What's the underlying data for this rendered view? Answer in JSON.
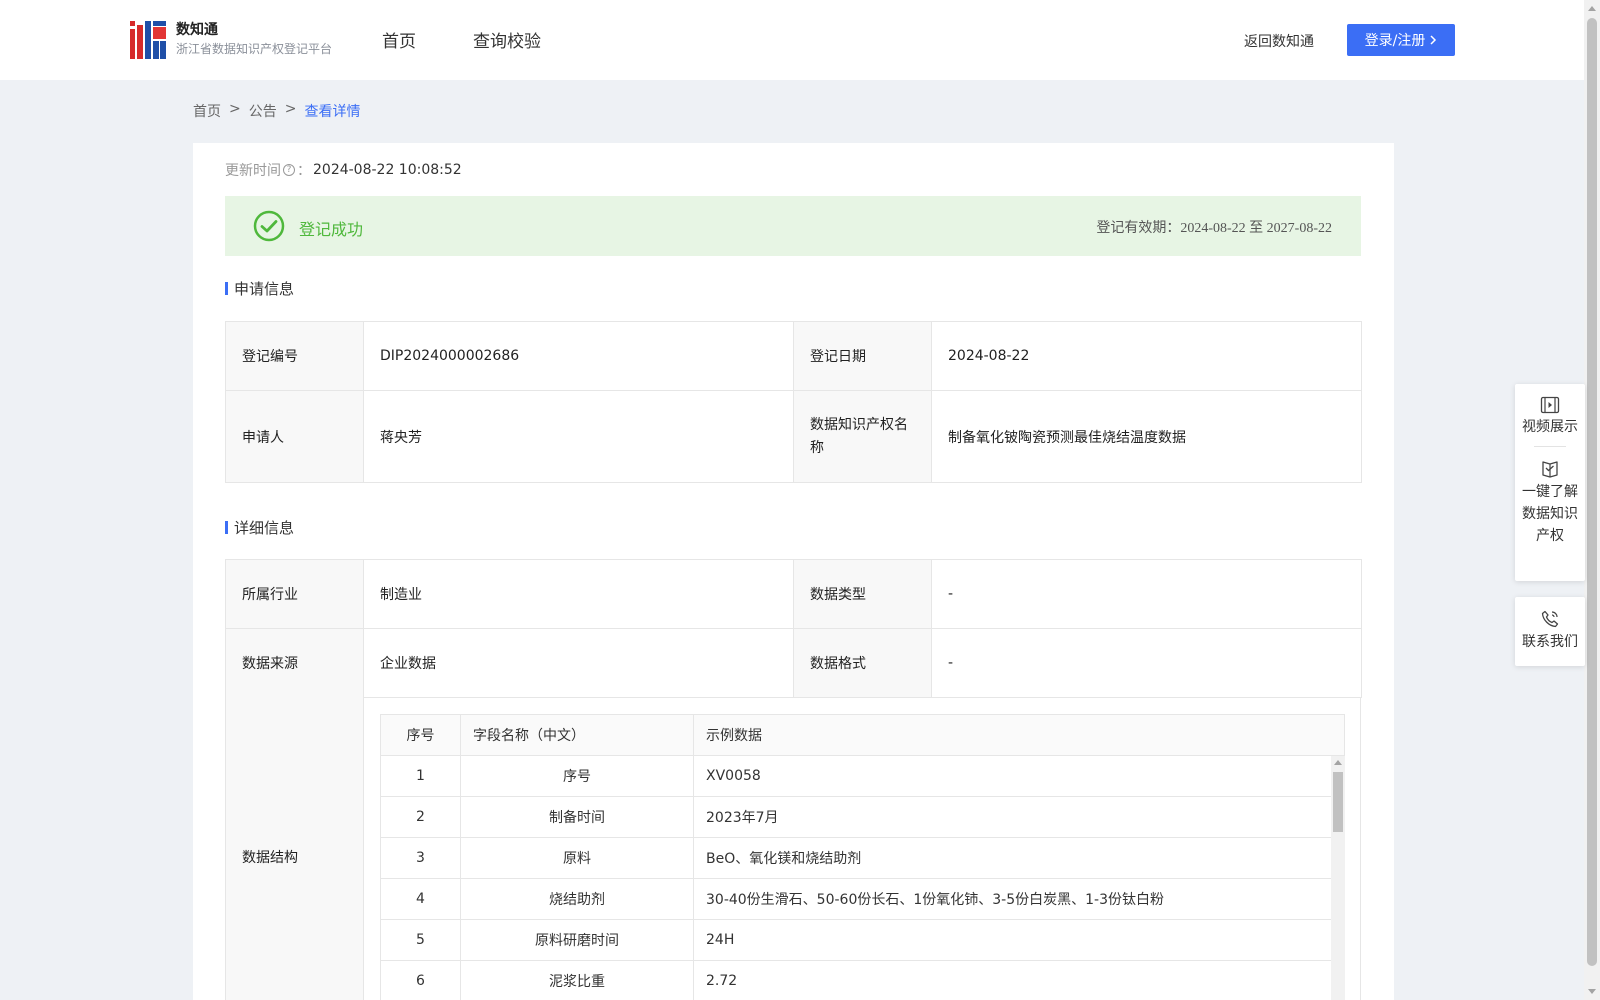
{
  "header": {
    "brand_name": "数知通",
    "brand_subtitle": "浙江省数据知识产权登记平台",
    "nav": [
      "首页",
      "查询校验"
    ],
    "back_link": "返回数知通",
    "login_label": "登录/注册",
    "accent_color": "#3b6ef5"
  },
  "breadcrumb": {
    "items": [
      "首页",
      "公告",
      "查看详情"
    ],
    "separator": ">"
  },
  "update": {
    "label": "更新时间",
    "value": "2024-08-22 10:08:52"
  },
  "status": {
    "text": "登记成功",
    "valid_label": "登记有效期：",
    "valid_dates": "2024-08-22 至 2027-08-22",
    "color": "#4fb83c"
  },
  "application": {
    "title": "申请信息",
    "reg_no_label": "登记编号",
    "reg_no": "DIP2024000002686",
    "reg_date_label": "登记日期",
    "reg_date": "2024-08-22",
    "applicant_label": "申请人",
    "applicant": "蒋央芳",
    "ip_name_label": "数据知识产权名称",
    "ip_name": "制备氧化铍陶瓷预测最佳烧结温度数据"
  },
  "details": {
    "title": "详细信息",
    "industry_label": "所属行业",
    "industry": "制造业",
    "data_type_label": "数据类型",
    "data_type": "-",
    "source_label": "数据来源",
    "source": "企业数据",
    "format_label": "数据格式",
    "format": "-",
    "structure_label": "数据结构",
    "structure_headers": [
      "序号",
      "字段名称（中文）",
      "示例数据"
    ],
    "structure_rows": [
      [
        "1",
        "序号",
        "XV0058"
      ],
      [
        "2",
        "制备时间",
        "2023年7月"
      ],
      [
        "3",
        "原料",
        "BeO、氧化镁和烧结助剂"
      ],
      [
        "4",
        "烧结助剂",
        "30-40份生滑石、50-60份长石、1份氧化铈、3-5份白炭黑、1-3份钛白粉"
      ],
      [
        "5",
        "原料研磨时间",
        "24H"
      ],
      [
        "6",
        "泥浆比重",
        "2.72"
      ]
    ]
  },
  "side_panel": {
    "video": "视频展示",
    "learn_lines": [
      "一键了解",
      "数据知识",
      "产权"
    ],
    "contact": "联系我们"
  }
}
